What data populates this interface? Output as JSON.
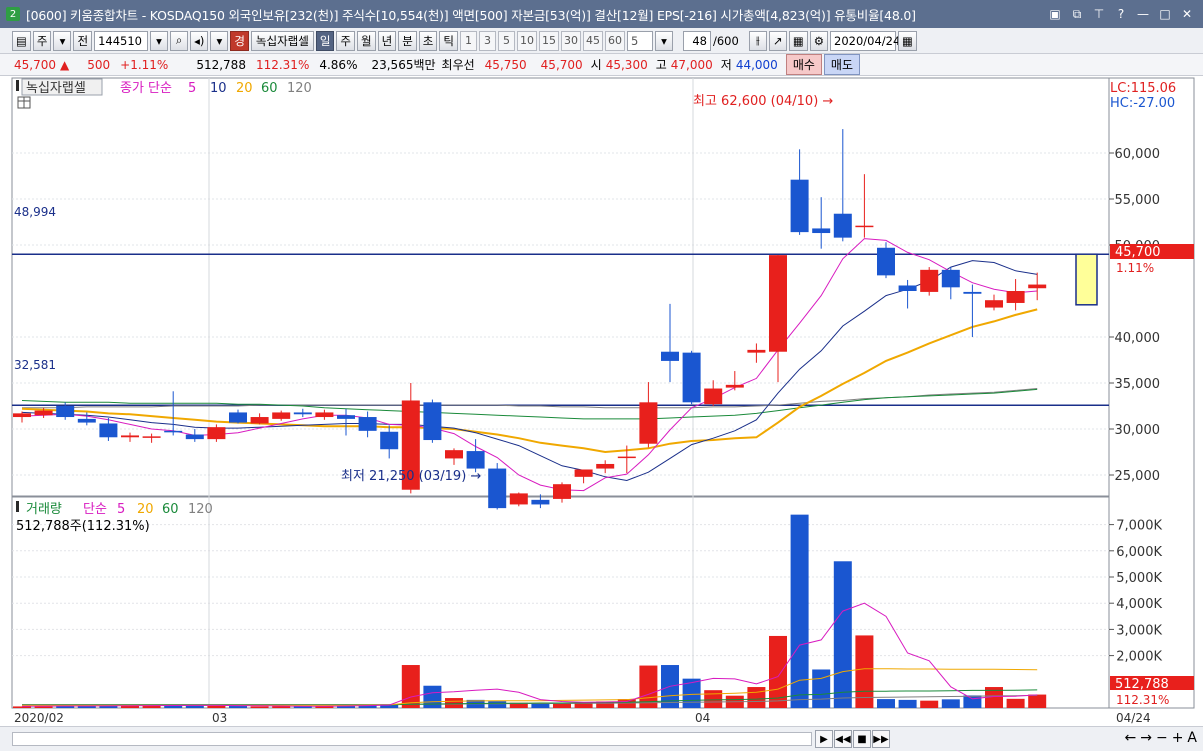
{
  "window": {
    "badge": "2",
    "title": "[0600] 키움종합차트 - KOSDAQ150 외국인보유[232(천)] 주식수[10,554(천)] 액면[500] 자본금[53(억)] 결산[12월] EPS[-216] 시가총액[4,823(억)] 유통비율[48.0]"
  },
  "toolbar": {
    "period_type": "주",
    "prev_label": "전",
    "stock_code": "144510",
    "stock_name": "녹십자랩셀",
    "stock_badge": "경",
    "periods": [
      "일",
      "주",
      "월",
      "년",
      "분",
      "초",
      "틱"
    ],
    "active_period": "일",
    "numbers": [
      "1",
      "3",
      "5",
      "10",
      "15",
      "30",
      "45",
      "60"
    ],
    "interval_value": "5",
    "count": "48",
    "count_total": "/600",
    "date": "2020/04/24"
  },
  "quote": {
    "price": "45,700",
    "arrow": "▲",
    "change": "500",
    "change_pct": "+1.11%",
    "volume": "512,788",
    "volume_ratio": "112.31%",
    "turnover": "4.86%",
    "trade_value": "23,565백만",
    "best_label": "최우선",
    "ask": "45,750",
    "bid": "45,700",
    "open_label": "시",
    "open": "45,300",
    "high_label": "고",
    "high": "47,000",
    "low_label": "저",
    "low": "44,000",
    "buy_label": "매수",
    "sell_label": "매도"
  },
  "price_panel": {
    "name_box": "녹십자랩셀",
    "legend_prefix": "종가 단순",
    "ma_labels": [
      "5",
      "10",
      "20",
      "60",
      "120"
    ],
    "lc": "LC:115.06",
    "hc": "HC:-27.00",
    "hline_high_label": "48,994",
    "hline_low_label": "32,581",
    "max_annotation": "최고 62,600 (04/10) →",
    "min_annotation": "최저 21,250 (03/19) →",
    "current_price": "45,700",
    "current_pct": "1.11%",
    "y_ticks": [
      "60,000",
      "55,000",
      "50,000",
      "40,000",
      "35,000",
      "30,000",
      "25,000"
    ]
  },
  "volume_panel": {
    "legend_prefix": "거래량",
    "legend_ma": "단순",
    "ma_labels": [
      "5",
      "20",
      "60",
      "120"
    ],
    "current_line": "512,788주(112.31%)",
    "y_ticks": [
      "7,000K",
      "6,000K",
      "5,000K",
      "4,000K",
      "3,000K",
      "2,000K"
    ],
    "current_volume": "512,788",
    "current_pct": "112.31%"
  },
  "x_axis": {
    "labels": [
      "2020/02",
      "03",
      "04"
    ],
    "end_label": "04/24"
  },
  "colors": {
    "up": "#e8201c",
    "down": "#1a56d0",
    "ma5": "#d81bc0",
    "ma10": "#1a2f8a",
    "ma20": "#f0a800",
    "ma60": "#1a8a3a",
    "ma120": "#808080"
  },
  "chart_data": {
    "type": "candlestick",
    "candles": [
      {
        "o": 31300,
        "h": 31900,
        "l": 30700,
        "c": 31700
      },
      {
        "o": 31500,
        "h": 32300,
        "l": 31200,
        "c": 32000
      },
      {
        "o": 32500,
        "h": 32900,
        "l": 31000,
        "c": 31300
      },
      {
        "o": 31100,
        "h": 31800,
        "l": 30400,
        "c": 30700
      },
      {
        "o": 30600,
        "h": 31200,
        "l": 28700,
        "c": 29100
      },
      {
        "o": 29100,
        "h": 29600,
        "l": 28600,
        "c": 29300
      },
      {
        "o": 29100,
        "h": 29500,
        "l": 28500,
        "c": 29200
      },
      {
        "o": 29800,
        "h": 34100,
        "l": 29300,
        "c": 29700
      },
      {
        "o": 29400,
        "h": 30000,
        "l": 28600,
        "c": 28900
      },
      {
        "o": 28900,
        "h": 30500,
        "l": 28600,
        "c": 30200
      },
      {
        "o": 31800,
        "h": 32100,
        "l": 30600,
        "c": 30700
      },
      {
        "o": 30600,
        "h": 31700,
        "l": 30500,
        "c": 31300
      },
      {
        "o": 31100,
        "h": 32000,
        "l": 30900,
        "c": 31800
      },
      {
        "o": 31800,
        "h": 32200,
        "l": 31300,
        "c": 31600
      },
      {
        "o": 31300,
        "h": 32100,
        "l": 31000,
        "c": 31800
      },
      {
        "o": 31500,
        "h": 32200,
        "l": 29300,
        "c": 31100
      },
      {
        "o": 31300,
        "h": 31900,
        "l": 29100,
        "c": 29800
      },
      {
        "o": 29700,
        "h": 30400,
        "l": 26800,
        "c": 27800
      },
      {
        "o": 23400,
        "h": 35000,
        "l": 23000,
        "c": 33100
      },
      {
        "o": 32900,
        "h": 33200,
        "l": 28500,
        "c": 28800
      },
      {
        "o": 26800,
        "h": 27900,
        "l": 26100,
        "c": 27700
      },
      {
        "o": 27600,
        "h": 28900,
        "l": 25300,
        "c": 25700
      },
      {
        "o": 25700,
        "h": 26300,
        "l": 21250,
        "c": 21400
      },
      {
        "o": 21800,
        "h": 23100,
        "l": 21600,
        "c": 23000
      },
      {
        "o": 22300,
        "h": 22900,
        "l": 21400,
        "c": 21800
      },
      {
        "o": 22400,
        "h": 24200,
        "l": 22000,
        "c": 24000
      },
      {
        "o": 24800,
        "h": 25500,
        "l": 24100,
        "c": 25600
      },
      {
        "o": 25700,
        "h": 26600,
        "l": 25200,
        "c": 26200
      },
      {
        "o": 26900,
        "h": 28200,
        "l": 25200,
        "c": 27000
      },
      {
        "o": 28400,
        "h": 35100,
        "l": 28000,
        "c": 32900
      },
      {
        "o": 38400,
        "h": 43600,
        "l": 35100,
        "c": 37400
      },
      {
        "o": 38300,
        "h": 38500,
        "l": 32700,
        "c": 32900
      },
      {
        "o": 32700,
        "h": 35300,
        "l": 32500,
        "c": 34400
      },
      {
        "o": 34500,
        "h": 36300,
        "l": 34200,
        "c": 34800
      },
      {
        "o": 38300,
        "h": 39300,
        "l": 37200,
        "c": 38600
      },
      {
        "o": 38400,
        "h": 48900,
        "l": 35100,
        "c": 48900
      },
      {
        "o": 57100,
        "h": 60400,
        "l": 51100,
        "c": 51400
      },
      {
        "o": 51800,
        "h": 55200,
        "l": 49600,
        "c": 51300
      },
      {
        "o": 53400,
        "h": 62600,
        "l": 50400,
        "c": 50800
      },
      {
        "o": 52000,
        "h": 57700,
        "l": 50800,
        "c": 52100
      },
      {
        "o": 49700,
        "h": 50300,
        "l": 46400,
        "c": 46700
      },
      {
        "o": 45600,
        "h": 46200,
        "l": 43100,
        "c": 45000
      },
      {
        "o": 44900,
        "h": 47600,
        "l": 44500,
        "c": 47300
      },
      {
        "o": 47300,
        "h": 47600,
        "l": 44100,
        "c": 45400
      },
      {
        "o": 44900,
        "h": 45700,
        "l": 40000,
        "c": 44700
      },
      {
        "o": 43200,
        "h": 44600,
        "l": 42900,
        "c": 44000
      },
      {
        "o": 43700,
        "h": 46300,
        "l": 42900,
        "c": 45000
      },
      {
        "o": 45300,
        "h": 47000,
        "l": 44000,
        "c": 45700
      }
    ],
    "ma5": [
      31400,
      31500,
      31600,
      31400,
      31000,
      30500,
      30000,
      29800,
      29300,
      29400,
      29600,
      30100,
      30600,
      31100,
      31500,
      31500,
      31200,
      30500,
      30400,
      30100,
      29500,
      28100,
      26900,
      25000,
      23900,
      23400,
      23300,
      24700,
      25100,
      27200,
      29900,
      32300,
      33300,
      34500,
      35500,
      38600,
      41500,
      44500,
      48500,
      50700,
      50500,
      49200,
      48400,
      47100,
      45900,
      45200,
      44800,
      45000
    ],
    "ma10": [
      31800,
      31700,
      31600,
      31500,
      31300,
      31000,
      30700,
      30500,
      30200,
      30100,
      30100,
      30200,
      30300,
      30400,
      30500,
      30600,
      30600,
      30500,
      30500,
      30300,
      30100,
      29600,
      28900,
      28200,
      27100,
      26000,
      25500,
      24800,
      24400,
      25300,
      26800,
      28300,
      29000,
      29800,
      31000,
      33900,
      36500,
      38500,
      41200,
      42800,
      44500,
      45200,
      46100,
      47600,
      48300,
      48100,
      47200,
      46800
    ],
    "ma20": [
      32200,
      32100,
      32000,
      31900,
      31700,
      31600,
      31400,
      31200,
      31000,
      30800,
      30700,
      30600,
      30500,
      30400,
      30300,
      30300,
      30300,
      30200,
      30200,
      30100,
      30000,
      29700,
      29400,
      29000,
      28500,
      28200,
      27900,
      27500,
      27700,
      27900,
      28400,
      28700,
      28800,
      29000,
      29100,
      30700,
      32400,
      33600,
      34900,
      36100,
      37400,
      38300,
      39300,
      40200,
      41100,
      41700,
      42400,
      43000
    ],
    "ma60": [
      33100,
      33000,
      32900,
      32900,
      32900,
      32800,
      32800,
      32800,
      32800,
      32800,
      32700,
      32700,
      32600,
      32500,
      32300,
      32200,
      32100,
      32000,
      31900,
      31800,
      31700,
      31600,
      31500,
      31400,
      31300,
      31200,
      31100,
      31100,
      31100,
      31100,
      31200,
      31300,
      31400,
      31500,
      31700,
      32000,
      32300,
      32600,
      32900,
      33200,
      33400,
      33500,
      33600,
      33700,
      33800,
      33900,
      34100,
      34300
    ],
    "ma120": [
      32300,
      32300,
      32300,
      32400,
      32400,
      32400,
      32400,
      32500,
      32500,
      32500,
      32500,
      32600,
      32600,
      32600,
      32600,
      32600,
      32600,
      32600,
      32600,
      32600,
      32600,
      32600,
      32600,
      32500,
      32500,
      32400,
      32400,
      32300,
      32300,
      32300,
      32300,
      32300,
      32400,
      32400,
      32500,
      32600,
      32800,
      33000,
      33100,
      33300,
      33400,
      33500,
      33700,
      33800,
      33900,
      34000,
      34200,
      34400
    ],
    "volumes": [
      60,
      55,
      70,
      80,
      90,
      95,
      100,
      110,
      95,
      80,
      75,
      60,
      70,
      75,
      60,
      85,
      120,
      140,
      1640,
      850,
      380,
      310,
      260,
      200,
      190,
      210,
      220,
      250,
      340,
      1620,
      1640,
      1120,
      680,
      470,
      800,
      2750,
      7380,
      1470,
      5600,
      2770,
      340,
      310,
      280,
      330,
      480,
      800,
      350,
      512.788
    ],
    "vol_ma5": [
      70,
      72,
      75,
      78,
      80,
      85,
      90,
      95,
      100,
      98,
      92,
      85,
      75,
      70,
      70,
      75,
      90,
      110,
      420,
      580,
      620,
      680,
      720,
      600,
      320,
      250,
      220,
      230,
      250,
      520,
      830,
      970,
      1130,
      1110,
      920,
      1200,
      2400,
      2600,
      3700,
      4000,
      3500,
      2100,
      1800,
      810,
      350,
      440,
      450,
      500
    ],
    "vol_ma20": [
      100,
      100,
      100,
      100,
      100,
      100,
      100,
      100,
      100,
      100,
      100,
      100,
      100,
      100,
      100,
      100,
      110,
      120,
      200,
      240,
      260,
      270,
      280,
      280,
      280,
      290,
      300,
      310,
      320,
      390,
      470,
      520,
      540,
      560,
      600,
      720,
      1060,
      1130,
      1390,
      1500,
      1500,
      1490,
      1490,
      1480,
      1480,
      1480,
      1470,
      1460
    ],
    "vol_ma60": [
      120,
      120,
      120,
      120,
      120,
      120,
      120,
      120,
      120,
      120,
      120,
      120,
      120,
      120,
      120,
      120,
      120,
      120,
      140,
      150,
      160,
      170,
      180,
      180,
      190,
      190,
      200,
      210,
      220,
      240,
      270,
      290,
      310,
      320,
      340,
      380,
      500,
      520,
      600,
      640,
      640,
      650,
      650,
      660,
      670,
      670,
      680,
      690
    ],
    "vol_ma120": [
      130,
      130,
      130,
      130,
      130,
      130,
      130,
      130,
      130,
      130,
      130,
      130,
      130,
      130,
      130,
      130,
      130,
      130,
      140,
      150,
      150,
      160,
      160,
      170,
      170,
      170,
      180,
      180,
      190,
      200,
      210,
      220,
      230,
      240,
      250,
      270,
      320,
      340,
      380,
      400,
      410,
      420,
      430,
      440,
      450,
      460,
      470,
      480
    ],
    "price_ylim": [
      20000,
      65000
    ],
    "volume_ylim": [
      0,
      7800
    ],
    "hlines": [
      48994,
      32581
    ],
    "forecast_box": {
      "low": 43500,
      "high": 49000
    }
  }
}
